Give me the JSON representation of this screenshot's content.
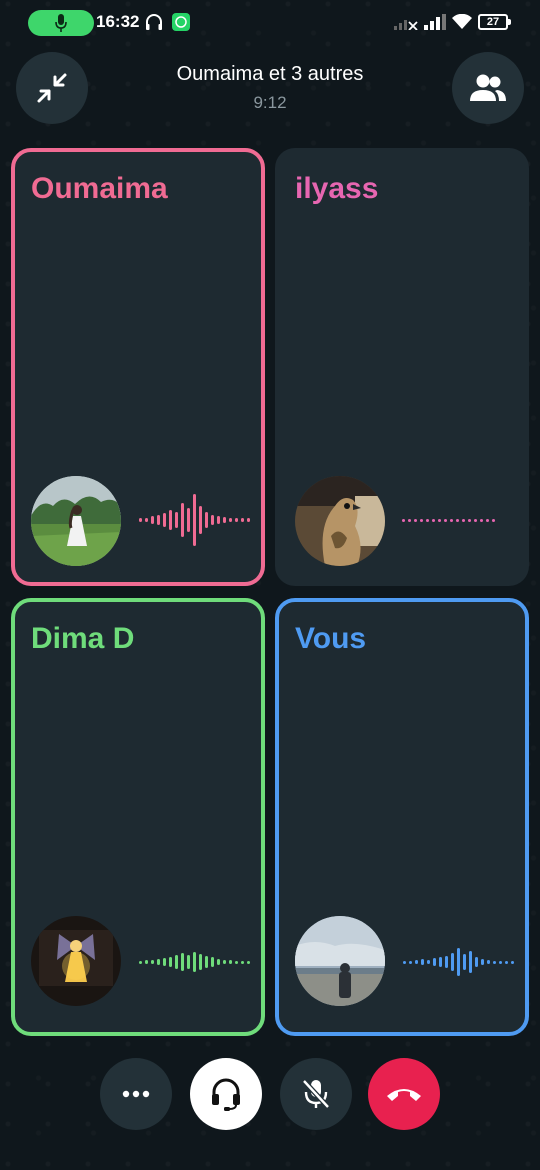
{
  "status_bar": {
    "time": "16:32",
    "battery": "27",
    "icons": [
      "mic-active-icon",
      "headphones-icon",
      "whatsapp-icon",
      "signal-off-icon",
      "signal-icon",
      "wifi-icon",
      "battery-icon"
    ]
  },
  "header": {
    "title": "Oumaima et 3 autres",
    "duration": "9:12",
    "minimize_icon": "minimize-icon",
    "participants_icon": "participants-icon"
  },
  "participants": [
    {
      "name": "Oumaima",
      "color": "#f06b93",
      "border": true,
      "speaking": true
    },
    {
      "name": "ilyass",
      "color": "#e766b1",
      "border": false,
      "speaking": false
    },
    {
      "name": "Dima D",
      "color": "#6fdc7b",
      "border": true,
      "speaking": true
    },
    {
      "name": "Vous",
      "color": "#4f9bf2",
      "border": true,
      "speaking": true
    }
  ],
  "controls": {
    "more_icon": "more-icon",
    "audio_route_icon": "headset-icon",
    "mute_icon": "mic-off-icon",
    "end_call_icon": "end-call-icon",
    "end_call_color": "#e8214f"
  }
}
